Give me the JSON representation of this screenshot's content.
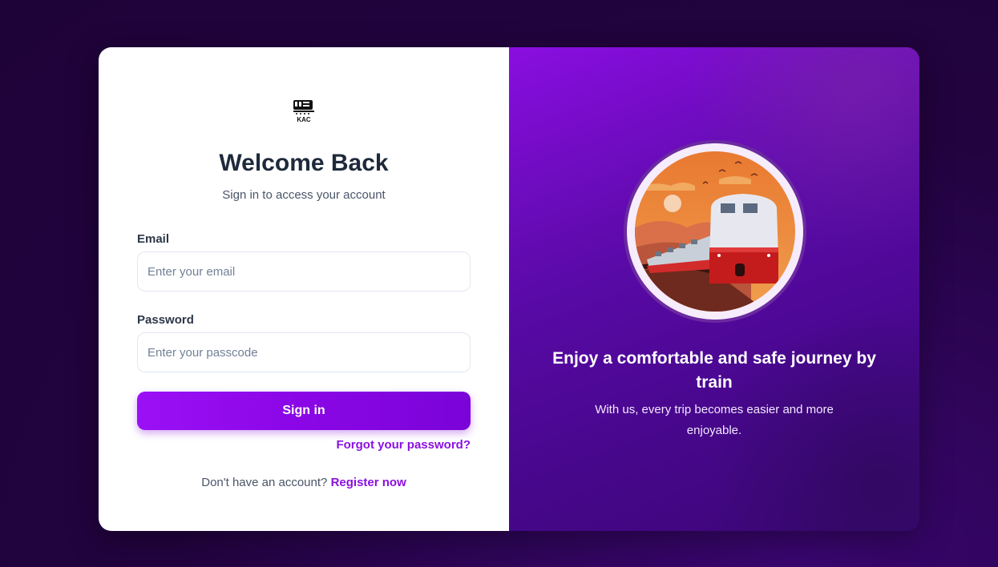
{
  "brand": {
    "logo_text": "KAC"
  },
  "login": {
    "title": "Welcome Back",
    "subtitle": "Sign in to access your account",
    "email_label": "Email",
    "email_placeholder": "Enter your email",
    "email_value": "",
    "password_label": "Password",
    "password_placeholder": "Enter your passcode",
    "password_value": "",
    "sign_in_label": "Sign in",
    "forgot_label": "Forgot your password?",
    "no_account_text": "Don't have an account?",
    "register_label": "Register now"
  },
  "promo": {
    "title": "Enjoy a comfortable and safe journey by train",
    "text": "With us, every trip becomes easier and more enjoyable."
  },
  "colors": {
    "accent": "#8a10e0",
    "background": "#22033f",
    "panel": "#5a0aa8"
  },
  "icons": {
    "logo": "train-logo-icon",
    "illustration": "train-illustration"
  }
}
